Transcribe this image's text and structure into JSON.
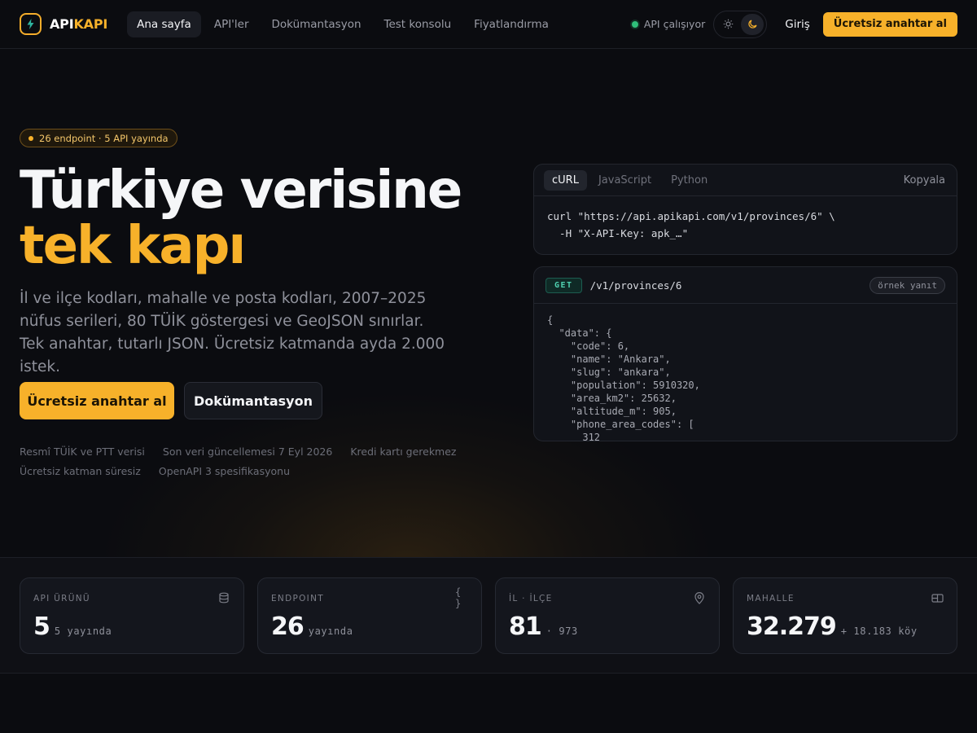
{
  "brand": {
    "part1": "API",
    "part2": "KAPI"
  },
  "nav": {
    "links": [
      "Ana sayfa",
      "API'ler",
      "Dokümantasyon",
      "Test konsolu",
      "Fiyatlandırma"
    ],
    "status": "API çalışıyor",
    "login": "Giriş",
    "cta": "Ücretsiz anahtar al"
  },
  "hero": {
    "badge": "26 endpoint · 5 API yayında",
    "title_line1": "Türkiye verisine",
    "title_line2": "tek kapı",
    "subtitle": "İl ve ilçe kodları, mahalle ve posta kodları, 2007–2025 nüfus serileri, 80 TÜİK göstergesi ve GeoJSON sınırlar. Tek anahtar, tutarlı JSON. Ücretsiz katmanda ayda 2.000 istek.",
    "primary_cta": "Ücretsiz anahtar al",
    "secondary_cta": "Dokümantasyon",
    "meta": [
      "Resmî TÜİK ve PTT verisi",
      "Son veri güncellemesi 7 Eyl 2026",
      "Kredi kartı gerekmez",
      "Ücretsiz katman süresiz",
      "OpenAPI 3 spesifikasyonu"
    ]
  },
  "request_panel": {
    "tabs": [
      "cURL",
      "JavaScript",
      "Python"
    ],
    "copy": "Kopyala",
    "code": "curl \"https://api.apikapi.com/v1/provinces/6\" \\\n  -H \"X-API-Key: apk_…\""
  },
  "response_panel": {
    "method": "GET",
    "path": "/v1/provinces/6",
    "badge": "örnek yanıt",
    "code": "{\n  \"data\": {\n    \"code\": 6,\n    \"name\": \"Ankara\",\n    \"slug\": \"ankara\",\n    \"population\": 5910320,\n    \"area_km2\": 25632,\n    \"altitude_m\": 905,\n    \"phone_area_codes\": [\n      312"
  },
  "stats": [
    {
      "label": "API ÜRÜNÜ",
      "value": "5",
      "sub": "5 yayında",
      "icon": "database-icon"
    },
    {
      "label": "ENDPOINT",
      "value": "26",
      "sub": "yayında",
      "icon": "braces-icon"
    },
    {
      "label": "İL · İLÇE",
      "value": "81",
      "sub": "· 973",
      "icon": "map-pin-icon"
    },
    {
      "label": "MAHALLE",
      "value": "32.279",
      "sub": "+ 18.183 köy",
      "icon": "card-icon"
    }
  ],
  "colors": {
    "accent": "#f7b12a",
    "status": "#2fbf7a",
    "get_method": "#4fd1b0",
    "background": "#0b0c10"
  }
}
